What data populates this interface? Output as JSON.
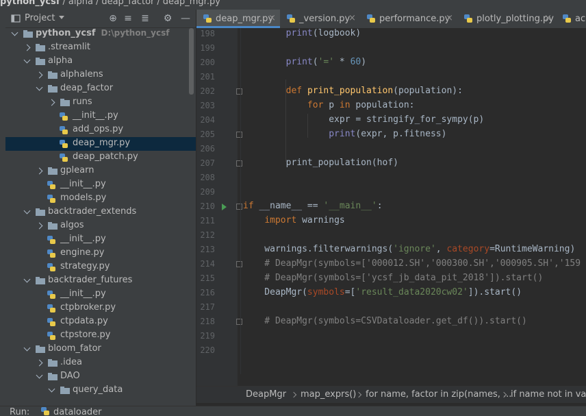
{
  "breadcrumb": {
    "items": [
      "python_ycsf",
      "alpha",
      "deap_factor",
      "deap_mgr.py"
    ]
  },
  "project_panel": {
    "title": "Project",
    "icons": [
      "globe-icon",
      "expand-all-icon",
      "collapse-all-icon",
      "gear-icon",
      "minimize-icon"
    ]
  },
  "tree": [
    {
      "label": "python_ycsf",
      "path": "D:\\python_ycsf",
      "type": "folder",
      "depth": 0,
      "expanded": true
    },
    {
      "label": ".streamlit",
      "type": "folder",
      "depth": 1,
      "expanded": false
    },
    {
      "label": "alpha",
      "type": "folder",
      "depth": 1,
      "expanded": true
    },
    {
      "label": "alphalens",
      "type": "folder",
      "depth": 2,
      "expanded": false
    },
    {
      "label": "deap_factor",
      "type": "folder",
      "depth": 2,
      "expanded": true
    },
    {
      "label": "runs",
      "type": "folder",
      "depth": 3,
      "expanded": false
    },
    {
      "label": "__init__.py",
      "type": "py",
      "depth": 3
    },
    {
      "label": "add_ops.py",
      "type": "py",
      "depth": 3
    },
    {
      "label": "deap_mgr.py",
      "type": "py",
      "depth": 3,
      "selected": true
    },
    {
      "label": "deap_patch.py",
      "type": "py",
      "depth": 3
    },
    {
      "label": "gplearn",
      "type": "folder",
      "depth": 2,
      "expanded": false
    },
    {
      "label": "__init__.py",
      "type": "py",
      "depth": 2
    },
    {
      "label": "models.py",
      "type": "py",
      "depth": 2
    },
    {
      "label": "backtrader_extends",
      "type": "folder",
      "depth": 1,
      "expanded": true
    },
    {
      "label": "algos",
      "type": "folder",
      "depth": 2,
      "expanded": false
    },
    {
      "label": "__init__.py",
      "type": "py",
      "depth": 2
    },
    {
      "label": "engine.py",
      "type": "py",
      "depth": 2
    },
    {
      "label": "strategy.py",
      "type": "py",
      "depth": 2
    },
    {
      "label": "backtrader_futures",
      "type": "folder",
      "depth": 1,
      "expanded": true
    },
    {
      "label": "__init__.py",
      "type": "py",
      "depth": 2
    },
    {
      "label": "ctpbroker.py",
      "type": "py",
      "depth": 2
    },
    {
      "label": "ctpdata.py",
      "type": "py",
      "depth": 2
    },
    {
      "label": "ctpstore.py",
      "type": "py",
      "depth": 2
    },
    {
      "label": "bloom_fator",
      "type": "folder",
      "depth": 1,
      "expanded": true
    },
    {
      "label": ".idea",
      "type": "folder",
      "depth": 2,
      "expanded": false
    },
    {
      "label": "DAO",
      "type": "folder",
      "depth": 2,
      "expanded": true
    },
    {
      "label": "query_data",
      "type": "folder",
      "depth": 3,
      "expanded": true
    }
  ],
  "tabs": [
    {
      "label": "deap_mgr.py",
      "active": true
    },
    {
      "label": "_version.py",
      "active": false
    },
    {
      "label": "performance.py",
      "active": false
    },
    {
      "label": "plotly_plotting.py",
      "active": false
    },
    {
      "label": "ac",
      "active": false
    }
  ],
  "code_lines": [
    {
      "n": "198",
      "text": "        print(logbook)"
    },
    {
      "n": "199",
      "text": ""
    },
    {
      "n": "200",
      "text": "        print('=' * 60)"
    },
    {
      "n": "201",
      "text": ""
    },
    {
      "n": "202",
      "text": "        def print_population(population):"
    },
    {
      "n": "203",
      "text": "            for p in population:"
    },
    {
      "n": "204",
      "text": "                expr = stringify_for_sympy(p)"
    },
    {
      "n": "205",
      "text": "                print(expr, p.fitness)"
    },
    {
      "n": "206",
      "text": ""
    },
    {
      "n": "207",
      "text": "        print_population(hof)"
    },
    {
      "n": "208",
      "text": ""
    },
    {
      "n": "209",
      "text": ""
    },
    {
      "n": "210",
      "text": "if __name__ == '__main__':"
    },
    {
      "n": "211",
      "text": "    import warnings"
    },
    {
      "n": "212",
      "text": ""
    },
    {
      "n": "213",
      "text": "    warnings.filterwarnings('ignore', category=RuntimeWarning)"
    },
    {
      "n": "214",
      "text": "    # DeapMgr(symbols=['000012.SH','000300.SH','000905.SH','159"
    },
    {
      "n": "215",
      "text": "    # DeapMgr(symbols=['ycsf_jb_data_pit_2018']).start()"
    },
    {
      "n": "216",
      "text": "    DeapMgr(symbols=['result_data2020cw02']).start()"
    },
    {
      "n": "217",
      "text": ""
    },
    {
      "n": "218",
      "text": "    # DeapMgr(symbols=CSVDataloader.get_df()).start()"
    },
    {
      "n": "219",
      "text": ""
    },
    {
      "n": "220",
      "text": ""
    }
  ],
  "code_breadcrumb": [
    "DeapMgr",
    "map_exprs()",
    "for name, factor in zip(names, ...",
    "if name not in valid"
  ],
  "run_bar": {
    "label": "Run:",
    "config": "dataloader"
  }
}
